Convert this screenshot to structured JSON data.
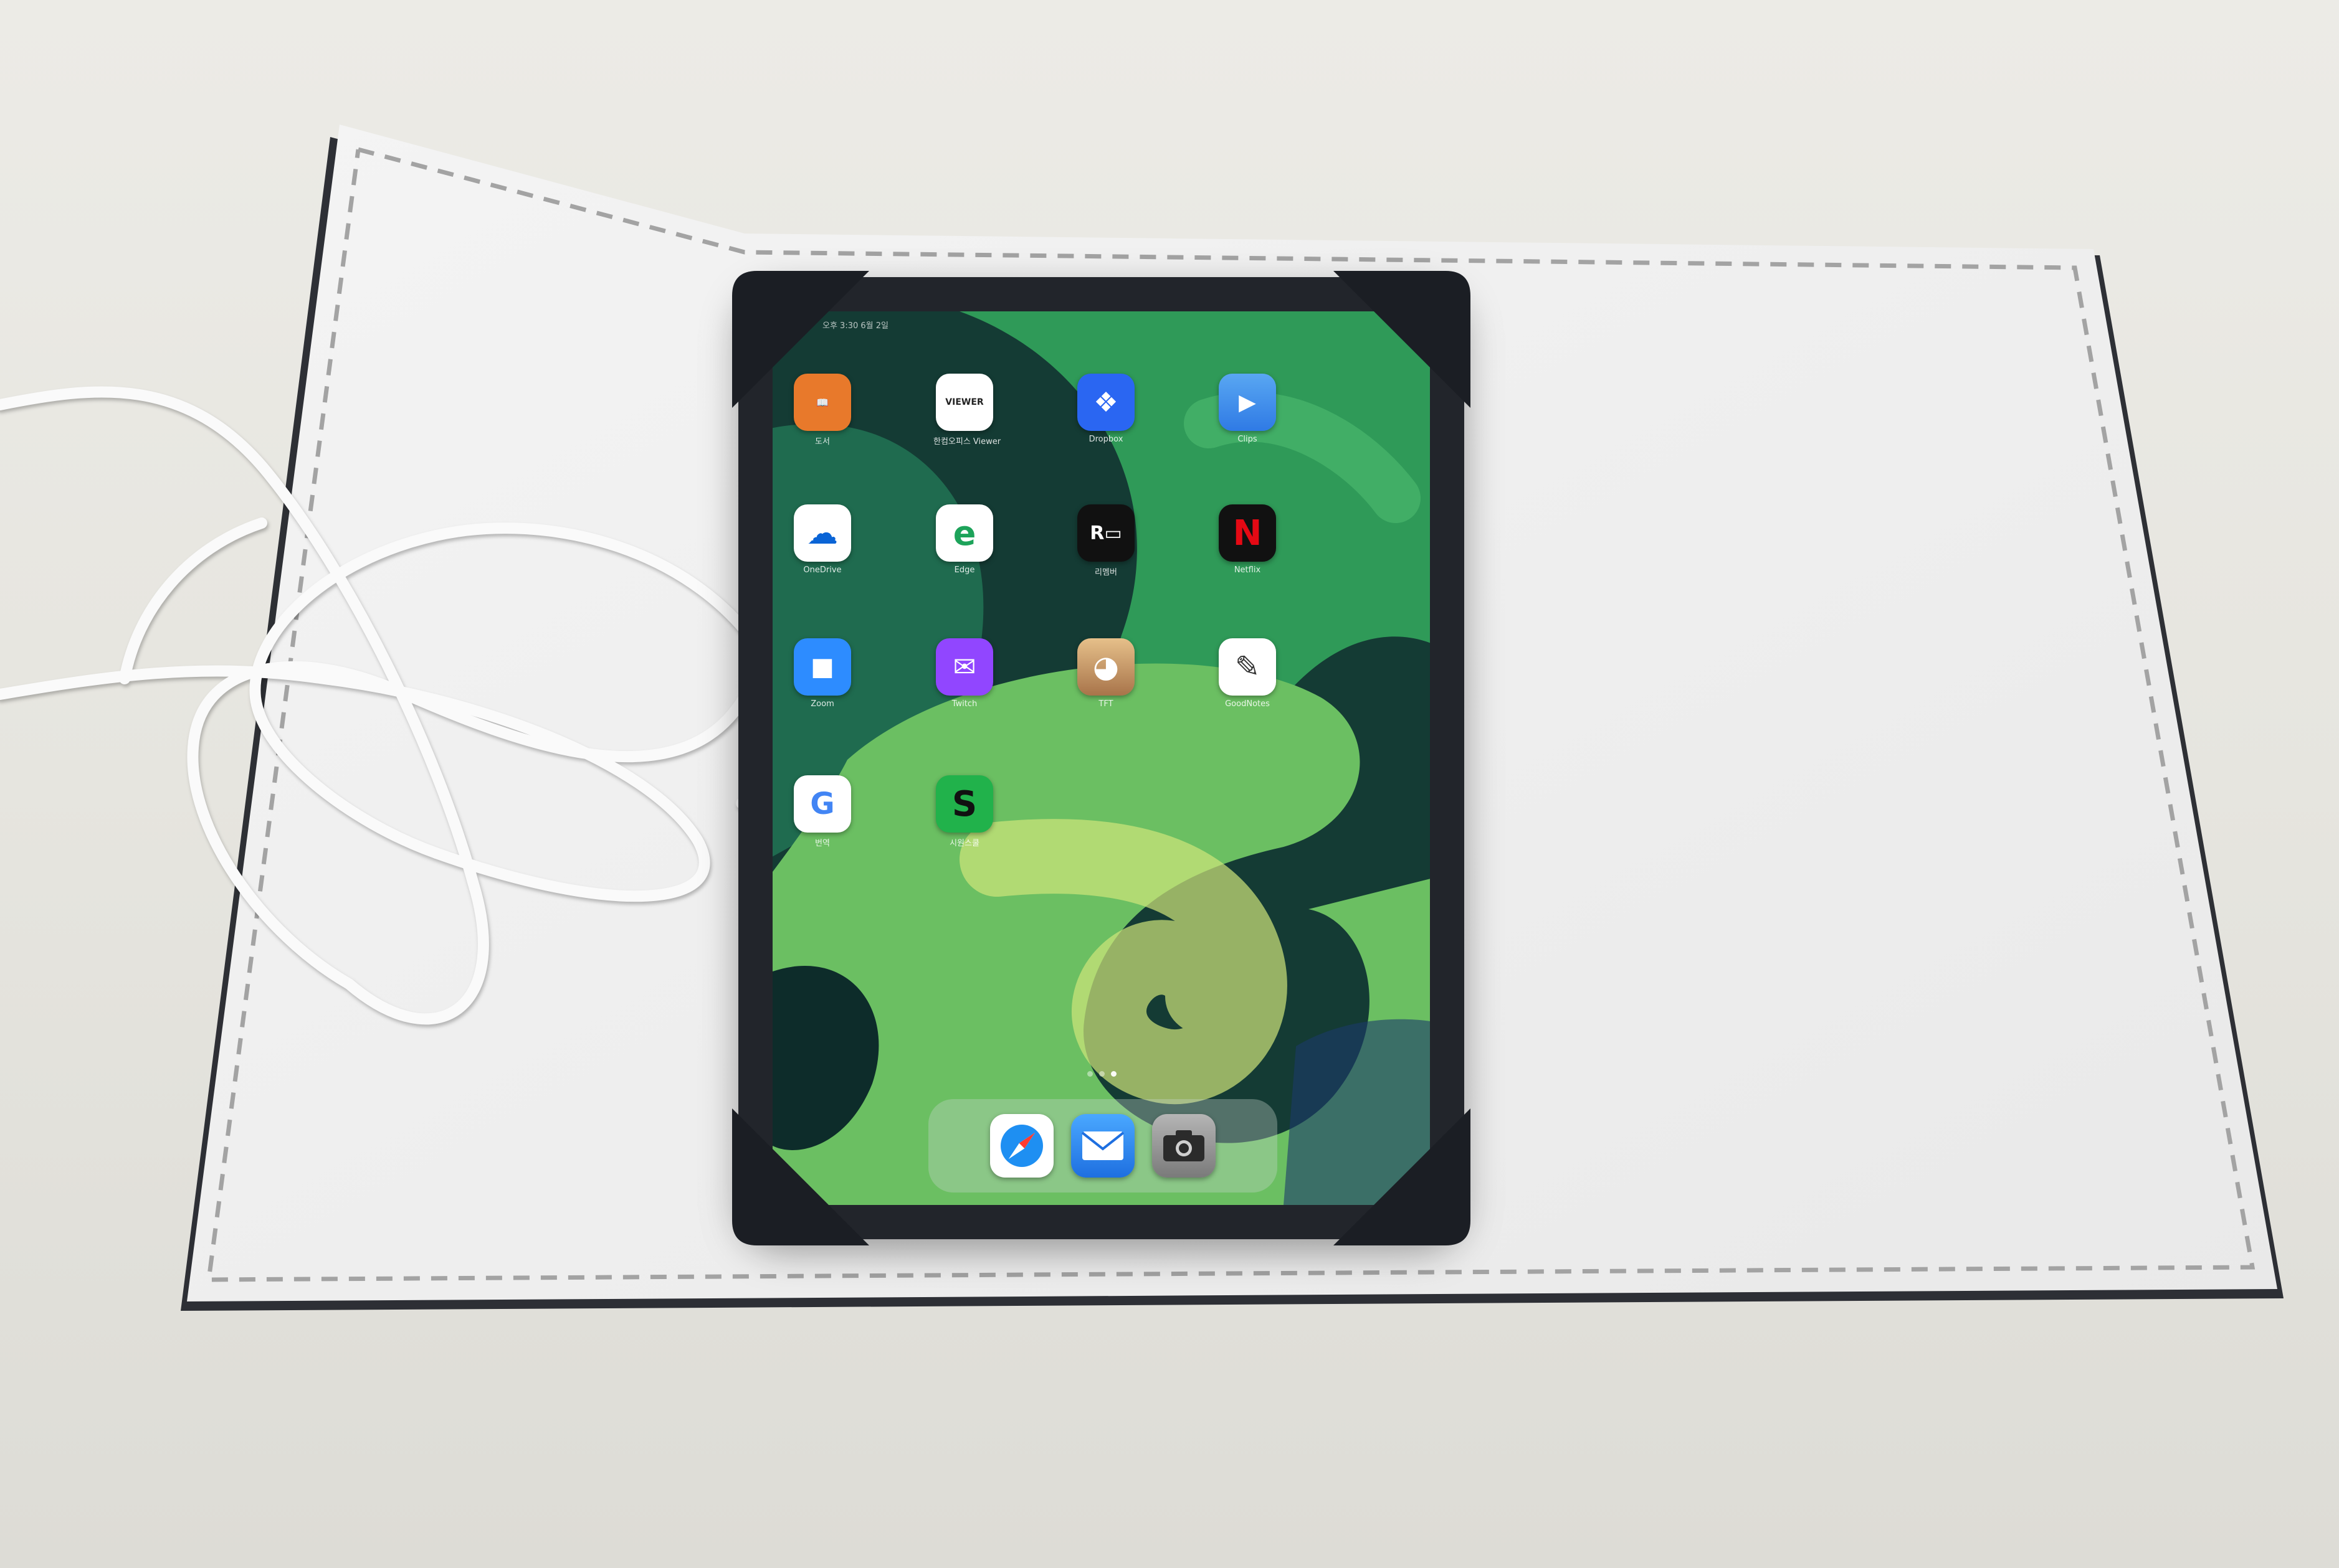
{
  "photo": {
    "subject": "tablet-in-felt-case",
    "colors": {
      "table": "#e6e5df",
      "felt": "#f1f1f1",
      "stitch": "#9a9a9a",
      "tablet_frame": "#22252b",
      "corner_strap": "#1b1e24",
      "cable": "#f7f7f7"
    }
  },
  "tablet": {
    "status_text": "오후 3:30 6월 2일",
    "apps": [
      {
        "name": "도서",
        "icon": "books-icon",
        "color": "#e8792b",
        "glyph": "📖"
      },
      {
        "name": "한컴오피스 Viewer",
        "icon": "viewer-icon",
        "color": "#ffffff",
        "glyph": "VIEWER"
      },
      {
        "name": "Dropbox",
        "icon": "dropbox-icon",
        "color": "#2a66f2",
        "glyph": "❖"
      },
      {
        "name": "Clips",
        "icon": "clips-icon",
        "color": "#2f7ae5",
        "glyph": "▶"
      },
      {
        "name": "OneDrive",
        "icon": "onedrive-icon",
        "color": "#ffffff",
        "glyph": "☁"
      },
      {
        "name": "Edge",
        "icon": "edge-icon",
        "color": "#ffffff",
        "glyph": "e"
      },
      {
        "name": "리멤버",
        "icon": "remember-icon",
        "color": "#111111",
        "glyph": "R▭"
      },
      {
        "name": "Netflix",
        "icon": "netflix-icon",
        "color": "#111111",
        "glyph": "N"
      },
      {
        "name": "Zoom",
        "icon": "zoom-icon",
        "color": "#2d8cff",
        "glyph": "■"
      },
      {
        "name": "Twitch",
        "icon": "twitch-icon",
        "color": "#9146ff",
        "glyph": "✉"
      },
      {
        "name": "TFT",
        "icon": "tft-icon",
        "color": "#c9a06a",
        "glyph": "◕"
      },
      {
        "name": "GoodNotes",
        "icon": "goodnotes-icon",
        "color": "#ffffff",
        "glyph": "✎"
      },
      {
        "name": "번역",
        "icon": "translate-icon",
        "color": "#ffffff",
        "glyph": "G"
      },
      {
        "name": "시원스쿨",
        "icon": "siwon-icon",
        "color": "#21b24b",
        "glyph": "S"
      }
    ],
    "page_dots": 3,
    "active_page": 3,
    "dock": [
      {
        "name": "Safari",
        "icon": "safari-icon",
        "color": "#ffffff"
      },
      {
        "name": "Mail",
        "icon": "mail-icon",
        "color": "#1e7cf2"
      },
      {
        "name": "Camera",
        "icon": "camera-icon",
        "color": "#8a8a8a"
      }
    ]
  }
}
